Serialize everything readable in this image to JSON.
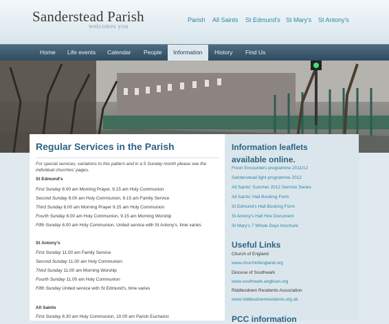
{
  "site": {
    "title": "Sanderstead Parish",
    "tagline": "welcomes you"
  },
  "top_links": [
    "Parish",
    "All Saints",
    "St Edmund's",
    "St Mary's",
    "St Antony's"
  ],
  "nav": {
    "items": [
      "Home",
      "Life events",
      "Calendar",
      "People",
      "Information",
      "History",
      "Find Us"
    ],
    "active": "Information"
  },
  "main": {
    "title": "Regular Services in the Parish",
    "intro": "For special services, variations to this pattern and in a 5 Sunday month please see the individual churches' pages.",
    "sections": [
      {
        "heading": "St Edmund's",
        "services": [
          {
            "day": "First Sunday",
            "detail": "8.00 am Morning Prayer, 9.15 am Holy Communion"
          },
          {
            "day": "Second Sunday",
            "detail": "8.00 am Holy Communion, 9.15 am Family Service"
          },
          {
            "day": "Third Sunday",
            "detail": "8.00 am Morning Prayer 9.15 am Holy Communion"
          },
          {
            "day": "Fourth Sunday",
            "detail": "8.00 am Holy Communion, 9.15 am Morning Worship"
          },
          {
            "day": "Fifth Sunday",
            "detail": "8.00 am Holy Communion, United service with St Antony's, time varies"
          }
        ]
      },
      {
        "heading": "St Antony's",
        "services": [
          {
            "day": "First Sunday",
            "detail": "11.00 am Family Service"
          },
          {
            "day": "Second Sunday",
            "detail": "11.00 am Holy Communion"
          },
          {
            "day": "Third Sunday",
            "detail": "11.00 am Morning Worship"
          },
          {
            "day": "Fourth Sunday",
            "detail": "11.00 am Holy Communion"
          },
          {
            "day": "Fifth Sunday",
            "detail": "United service with St Edmund's, time varies"
          }
        ]
      },
      {
        "heading": "All Saints",
        "services": [
          {
            "day": "First Sunday",
            "detail": "8.30 am Holy Communion, 10.00 am Parish Eucharist"
          }
        ]
      }
    ]
  },
  "sidebar": {
    "leaflets_heading_1": "Information leaflets",
    "leaflets_heading_2": "available online.",
    "leaflets": [
      "Fresh Encounters programme 2011/12",
      "Sanderstead light programme 2012",
      "All Saints' Summer 2012 Sermon Series",
      "All Saints' Hall Booking Form",
      "St Edmund's Hall Booking Form",
      "St Antony's Hall Hire Document",
      "St Mary's 7 Whole Days brochure"
    ],
    "links_heading": "Useful Links",
    "links": [
      {
        "label": "Church of England",
        "url": "www.churchofengland.org"
      },
      {
        "label": "Diocese of Southwark",
        "url": "www.southwark.anglican.org"
      },
      {
        "label": "Riddlesdown Residents Association",
        "url": "www.riddlesdownresidents.org.uk"
      }
    ],
    "pcc_heading": "PCC information"
  },
  "colors": {
    "accent": "#2a6383",
    "link": "#2b86a8",
    "nav_bg": "#3a586d",
    "sidebar_bg": "#dbe6ec"
  }
}
